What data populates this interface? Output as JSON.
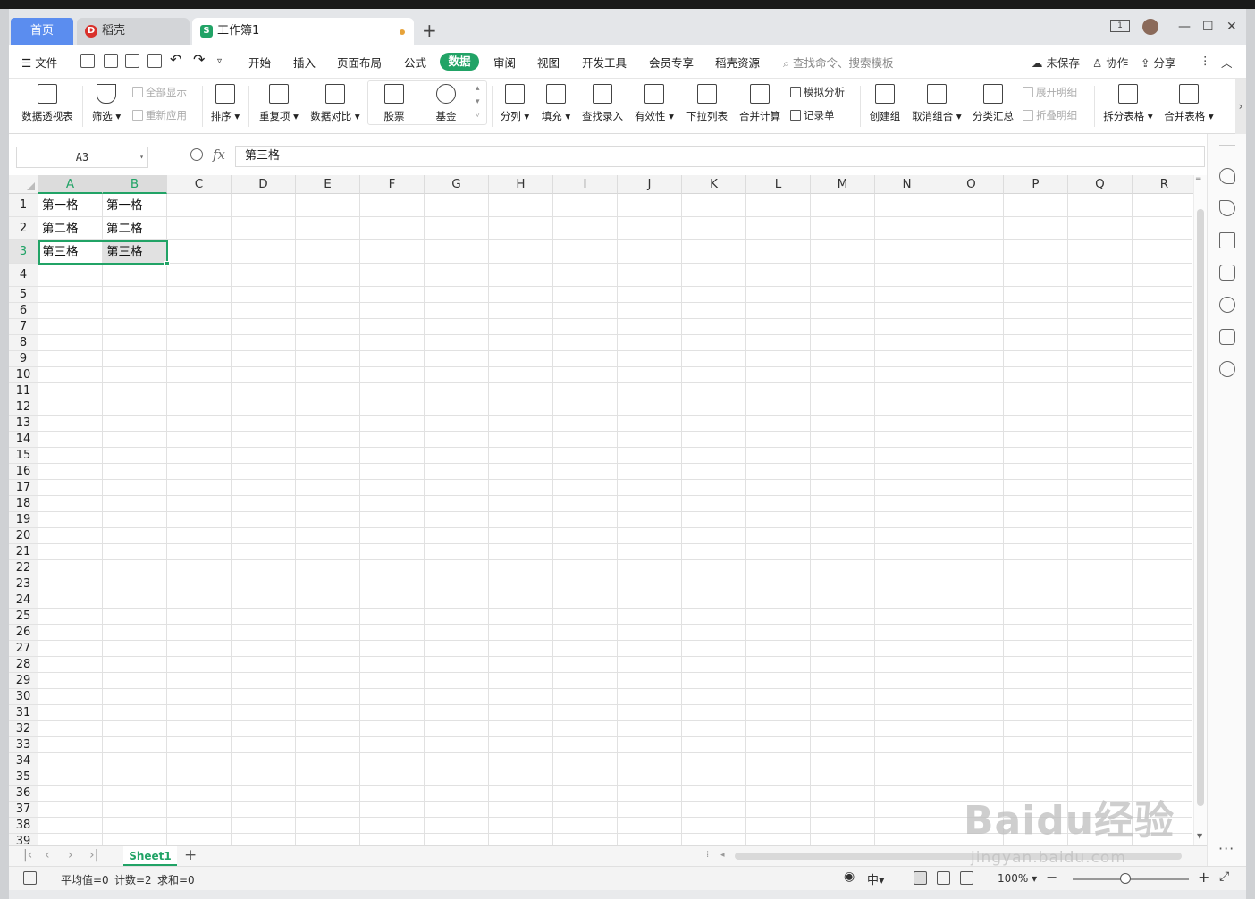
{
  "tabs": {
    "home": "首页",
    "docer": "稻壳",
    "workbook": "工作簿1"
  },
  "window_controls": [
    "1",
    "—",
    "☐",
    "✕"
  ],
  "menu": {
    "file": "文件",
    "items": [
      "开始",
      "插入",
      "页面布局",
      "公式",
      "数据",
      "审阅",
      "视图",
      "开发工具",
      "会员专享",
      "稻壳资源"
    ],
    "active": "数据",
    "search_placeholder": "查找命令、搜索模板",
    "unsaved": "未保存",
    "collaborate": "协作",
    "share": "分享"
  },
  "ribbon": {
    "pivot": "数据透视表",
    "filter": "筛选",
    "show_all": "全部显示",
    "reapply": "重新应用",
    "sort": "排序",
    "duplicates": "重复项",
    "compare": "数据对比",
    "stock": "股票",
    "fund": "基金",
    "split_col": "分列",
    "fill": "填充",
    "lookup": "查找录入",
    "validity": "有效性",
    "dropdown": "下拉列表",
    "consolidate": "合并计算",
    "what_if": "模拟分析",
    "record_form": "记录单",
    "group": "创建组",
    "ungroup": "取消组合",
    "subtotal": "分类汇总",
    "expand_detail": "展开明细",
    "collapse_detail": "折叠明细",
    "split_table": "拆分表格",
    "merge_table": "合并表格"
  },
  "formula_bar": {
    "name_box": "A3",
    "fx": "fx",
    "content": "第三格"
  },
  "columns": [
    "A",
    "B",
    "C",
    "D",
    "E",
    "F",
    "G",
    "H",
    "I",
    "J",
    "K",
    "L",
    "M",
    "N",
    "O",
    "P",
    "Q",
    "R"
  ],
  "rows": [
    "1",
    "2",
    "3",
    "4",
    "5",
    "6",
    "7",
    "8",
    "9",
    "10",
    "11",
    "12",
    "13",
    "14",
    "15",
    "16",
    "17",
    "18",
    "19",
    "20",
    "21",
    "22",
    "23",
    "24",
    "25",
    "26",
    "27",
    "28",
    "29",
    "30",
    "31",
    "32",
    "33",
    "34",
    "35",
    "36",
    "37",
    "38",
    "39"
  ],
  "cells": {
    "A1": "第一格",
    "B1": "第一格",
    "A2": "第二格",
    "B2": "第二格",
    "A3": "第三格",
    "B3": "第三格"
  },
  "sheet_tab": "Sheet1",
  "status": {
    "average": "平均值=0",
    "count": "计数=2",
    "sum": "求和=0",
    "zoom": "100%"
  },
  "colors": {
    "accent": "#21a366",
    "home_tab": "#5b8def"
  },
  "watermark": {
    "main": "Baidu经验",
    "sub": "jingyan.baidu.com"
  }
}
